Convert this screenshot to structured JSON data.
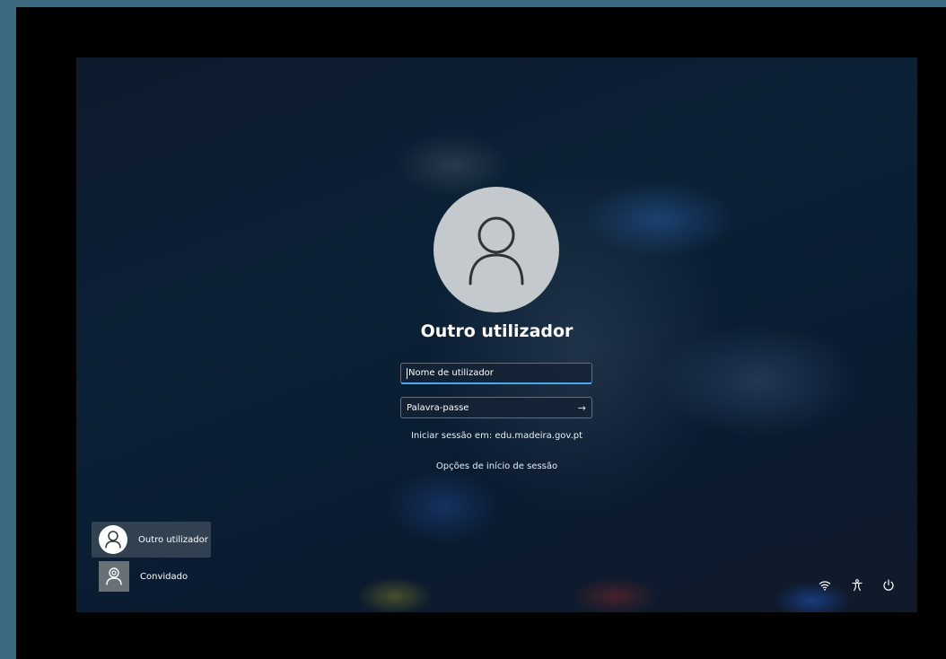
{
  "login": {
    "user_name": "Outro utilizador",
    "username_placeholder": "Nome de utilizador",
    "password_placeholder": "Palavra-passe",
    "sign_in_domain": "Iniciar sessão em: edu.madeira.gov.pt",
    "sign_in_options": "Opções de início de sessão"
  },
  "user_list": [
    {
      "label": "Outro utilizador",
      "icon": "person-icon",
      "selected": true
    },
    {
      "label": "Convidado",
      "icon": "guest-icon",
      "selected": false
    }
  ],
  "tray": [
    {
      "icon": "wifi-icon"
    },
    {
      "icon": "accessibility-icon"
    },
    {
      "icon": "power-icon"
    }
  ],
  "colors": {
    "accent": "#4ca6f0",
    "avatar_bg": "#c4c9ce",
    "outer_bg": "#3b6a80"
  }
}
